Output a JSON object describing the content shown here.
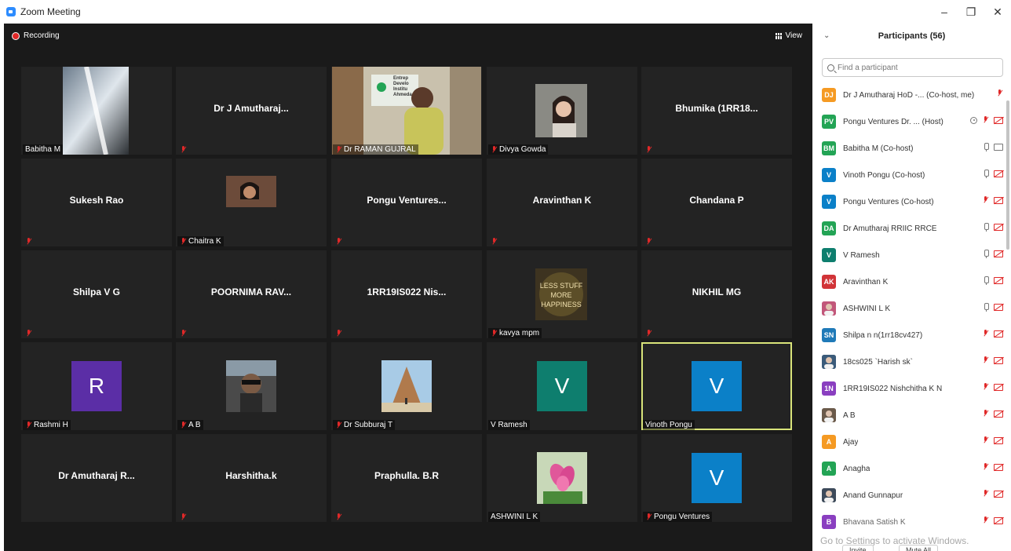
{
  "window": {
    "title": "Zoom Meeting",
    "minimize": "–",
    "restore": "❐",
    "close": "✕"
  },
  "stage": {
    "recording": "Recording",
    "view": "View"
  },
  "tiles": [
    {
      "caption": "Babitha M",
      "big": "",
      "muted": false,
      "kind": "photo",
      "photo": "window"
    },
    {
      "caption": "",
      "big": "Dr J Amutharaj...",
      "muted": true,
      "kind": "name"
    },
    {
      "caption": "Dr RAMAN GUJRAL",
      "big": "",
      "muted": true,
      "kind": "photo",
      "photo": "video"
    },
    {
      "caption": "Divya Gowda",
      "big": "",
      "muted": true,
      "kind": "photo",
      "photo": "portrait"
    },
    {
      "caption": "",
      "big": "Bhumika  (1RR18...",
      "muted": true,
      "kind": "name"
    },
    {
      "caption": "",
      "big": "Sukesh Rao",
      "muted": true,
      "kind": "name"
    },
    {
      "caption": "Chaitra K",
      "big": "",
      "muted": true,
      "kind": "photo",
      "photo": "portrait2"
    },
    {
      "caption": "",
      "big": "Pongu  Ventures...",
      "muted": true,
      "kind": "name"
    },
    {
      "caption": "",
      "big": "Aravinthan K",
      "muted": true,
      "kind": "name"
    },
    {
      "caption": "",
      "big": "Chandana P",
      "muted": true,
      "kind": "name"
    },
    {
      "caption": "",
      "big": "Shilpa V G",
      "muted": true,
      "kind": "name"
    },
    {
      "caption": "",
      "big": "POORNIMA  RAV...",
      "muted": true,
      "kind": "name"
    },
    {
      "caption": "",
      "big": "1RR19IS022  Nis...",
      "muted": true,
      "kind": "name"
    },
    {
      "caption": "kavya mpm",
      "big": "",
      "muted": true,
      "kind": "photo",
      "photo": "quote"
    },
    {
      "caption": "",
      "big": "NIKHIL MG",
      "muted": true,
      "kind": "name"
    },
    {
      "caption": "Rashmi H",
      "big": "",
      "muted": true,
      "kind": "avatar",
      "letter": "R",
      "color": "#5b2ea6"
    },
    {
      "caption": "A B",
      "big": "",
      "muted": true,
      "kind": "photo",
      "photo": "car"
    },
    {
      "caption": "Dr Subburaj T",
      "big": "",
      "muted": true,
      "kind": "photo",
      "photo": "temple"
    },
    {
      "caption": "V Ramesh",
      "big": "",
      "muted": false,
      "kind": "avatar",
      "letter": "V",
      "color": "#0e7e6e"
    },
    {
      "caption": "Vinoth Pongu",
      "big": "",
      "muted": false,
      "kind": "avatar",
      "letter": "V",
      "color": "#0b80c8",
      "active": true
    },
    {
      "caption": "",
      "big": "Dr Amutharaj R...",
      "muted": false,
      "kind": "name"
    },
    {
      "caption": "",
      "big": "Harshitha.k",
      "muted": true,
      "kind": "name"
    },
    {
      "caption": "",
      "big": "Praphulla. B.R",
      "muted": true,
      "kind": "name"
    },
    {
      "caption": "ASHWINI L K",
      "big": "",
      "muted": false,
      "kind": "photo",
      "photo": "flower"
    },
    {
      "caption": "Pongu Ventures",
      "big": "",
      "muted": true,
      "kind": "avatar",
      "letter": "V",
      "color": "#0b80c8"
    }
  ],
  "quote_text": [
    "LESS STUFF",
    "MORE",
    "HAPPINESS"
  ],
  "video_sign": [
    "Entrep",
    "Develo",
    "Institu",
    "Ahmeda"
  ],
  "panel": {
    "title": "Participants (56)",
    "search_placeholder": "Find a participant",
    "watermark": "Go to Settings to activate Windows.",
    "watermark_top": "Activate Windows",
    "invite": "Invite",
    "mute_all": "Mute All"
  },
  "participants": [
    {
      "initials": "DJ",
      "color": "#f59a23",
      "name": "Dr J Amutharaj HoD -... (Co-host, me)",
      "icons": [
        "mic-off"
      ]
    },
    {
      "initials": "PV",
      "color": "#23a455",
      "name": "Pongu Ventures Dr. ...  (Host)",
      "icons": [
        "share",
        "mic-off",
        "cam-off"
      ]
    },
    {
      "initials": "BM",
      "color": "#23a455",
      "name": "Babitha M (Co-host)",
      "icons": [
        "mic",
        "cam"
      ]
    },
    {
      "initials": "V",
      "color": "#0b80c8",
      "name": "Vinoth Pongu (Co-host)",
      "icons": [
        "mic",
        "cam-off"
      ]
    },
    {
      "initials": "V",
      "color": "#0b80c8",
      "name": "Pongu Ventures (Co-host)",
      "icons": [
        "mic-off",
        "cam-off"
      ]
    },
    {
      "initials": "DA",
      "color": "#23a455",
      "name": "Dr Amutharaj RRIIC RRCE",
      "icons": [
        "mic",
        "cam-off"
      ]
    },
    {
      "initials": "V",
      "color": "#0e7e6e",
      "name": "V Ramesh",
      "icons": [
        "mic",
        "cam-off"
      ]
    },
    {
      "initials": "AK",
      "color": "#d13438",
      "name": "Aravinthan K",
      "icons": [
        "mic",
        "cam-off"
      ]
    },
    {
      "initials": "",
      "color": "#c2577a",
      "name": "ASHWINI L K",
      "icons": [
        "mic",
        "cam-off"
      ],
      "photo": true
    },
    {
      "initials": "SN",
      "color": "#1f7ab8",
      "name": "Shilpa n n(1rr18cv427)",
      "icons": [
        "mic-off",
        "cam-off"
      ]
    },
    {
      "initials": "",
      "color": "#3b5b7a",
      "name": "18cs025 `Harish sk`",
      "icons": [
        "mic-off",
        "cam-off"
      ],
      "photo": true
    },
    {
      "initials": "1N",
      "color": "#8a3fc0",
      "name": "1RR19IS022 Nishchitha K N",
      "icons": [
        "mic-off",
        "cam-off"
      ]
    },
    {
      "initials": "",
      "color": "#6b5a4a",
      "name": "A B",
      "icons": [
        "mic-off",
        "cam-off"
      ],
      "photo": true
    },
    {
      "initials": "A",
      "color": "#f59a23",
      "name": "Ajay",
      "icons": [
        "mic-off",
        "cam-off"
      ]
    },
    {
      "initials": "A",
      "color": "#23a455",
      "name": "Anagha",
      "icons": [
        "mic-off",
        "cam-off"
      ]
    },
    {
      "initials": "",
      "color": "#3d4a5a",
      "name": "Anand Gunnapur",
      "icons": [
        "mic-off",
        "cam-off"
      ],
      "photo": true
    },
    {
      "initials": "B",
      "color": "#8a3fc0",
      "name": "Bhavana Satish K",
      "icons": [
        "mic-off",
        "cam-off"
      ]
    }
  ]
}
